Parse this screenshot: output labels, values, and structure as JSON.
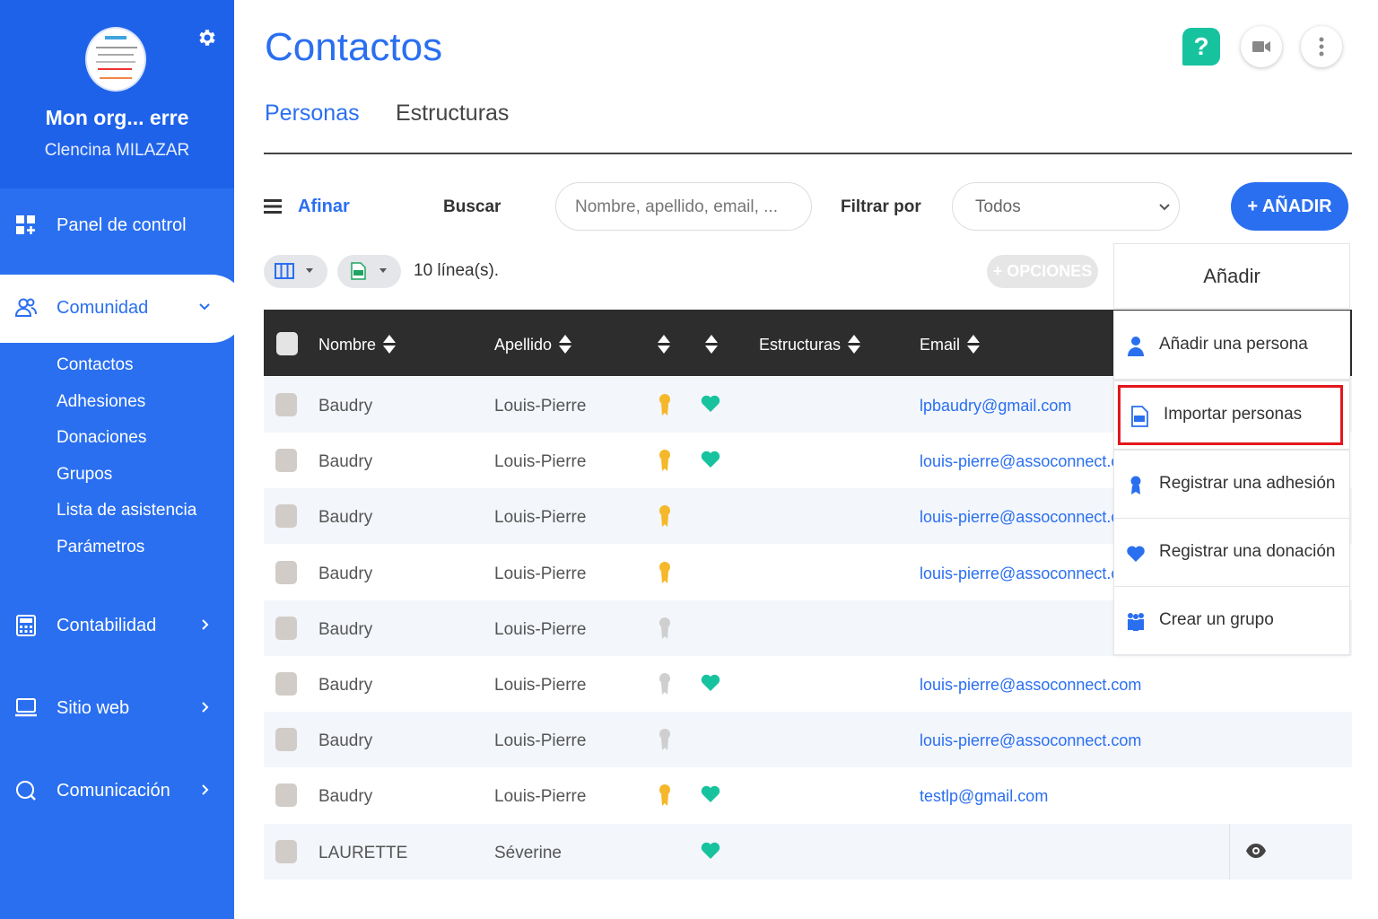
{
  "sidebar": {
    "org_name": "Mon org... erre",
    "user_name": "Clencina MILAZAR",
    "nav": [
      {
        "label": "Panel de control",
        "icon": "dashboard-icon"
      },
      {
        "label": "Comunidad",
        "icon": "community-icon",
        "active": true
      },
      {
        "label": "Contabilidad",
        "icon": "calculator-icon"
      },
      {
        "label": "Sitio web",
        "icon": "monitor-icon"
      },
      {
        "label": "Comunicación",
        "icon": "chat-icon"
      }
    ],
    "sub_items": [
      "Contactos",
      "Adhesiones",
      "Donaciones",
      "Grupos",
      "Lista de asistencia",
      "Parámetros"
    ]
  },
  "header": {
    "title": "Contactos",
    "help_label": "?",
    "tabs": [
      "Personas",
      "Estructuras"
    ]
  },
  "filters": {
    "afinar": "Afinar",
    "buscar": "Buscar",
    "search_placeholder": "Nombre, apellido, email, ...",
    "filtrar_por": "Filtrar por",
    "filter_value": "Todos",
    "add_button": "+ AÑADIR"
  },
  "toolbar": {
    "lines_count": "10 línea(s).",
    "opciones": "+ OPCIONES"
  },
  "table": {
    "headers": [
      "Nombre",
      "Apellido",
      "Estructuras",
      "Email"
    ],
    "rows": [
      {
        "nombre": "Baudry",
        "apellido": "Louis-Pierre",
        "medal": "gold",
        "heart": true,
        "email": "lpbaudry@gmail.com"
      },
      {
        "nombre": "Baudry",
        "apellido": "Louis-Pierre",
        "medal": "gold",
        "heart": true,
        "email": "louis-pierre@assoconnect.com"
      },
      {
        "nombre": "Baudry",
        "apellido": "Louis-Pierre",
        "medal": "gold",
        "heart": false,
        "email": "louis-pierre@assoconnect.com"
      },
      {
        "nombre": "Baudry",
        "apellido": "Louis-Pierre",
        "medal": "gold",
        "heart": false,
        "email": "louis-pierre@assoconnect.com"
      },
      {
        "nombre": "Baudry",
        "apellido": "Louis-Pierre",
        "medal": "gray",
        "heart": false,
        "email": ""
      },
      {
        "nombre": "Baudry",
        "apellido": "Louis-Pierre",
        "medal": "gray",
        "heart": true,
        "email": "louis-pierre@assoconnect.com"
      },
      {
        "nombre": "Baudry",
        "apellido": "Louis-Pierre",
        "medal": "gray",
        "heart": false,
        "email": "louis-pierre@assoconnect.com"
      },
      {
        "nombre": "Baudry",
        "apellido": "Louis-Pierre",
        "medal": "gold",
        "heart": true,
        "email": "testlp@gmail.com"
      },
      {
        "nombre": "LAURETTE",
        "apellido": "Séverine",
        "medal": "",
        "heart": true,
        "email": "",
        "eye": true
      }
    ]
  },
  "dropdown": {
    "title": "Añadir",
    "items": [
      {
        "label": "Añadir una persona",
        "icon": "person-icon"
      },
      {
        "label": "Importar personas",
        "icon": "import-file-icon",
        "highlighted": true
      },
      {
        "label": "Registrar una adhesión",
        "icon": "membership-icon"
      },
      {
        "label": "Registrar una donación",
        "icon": "heart-icon"
      },
      {
        "label": "Crear un grupo",
        "icon": "group-icon"
      }
    ]
  },
  "colors": {
    "primary": "#2a6ff0",
    "sidebar": "#2a6ff0",
    "help": "#17c39e",
    "heart": "#17c39e",
    "medal_gold": "#f5b82a",
    "highlight": "#e3161c"
  }
}
